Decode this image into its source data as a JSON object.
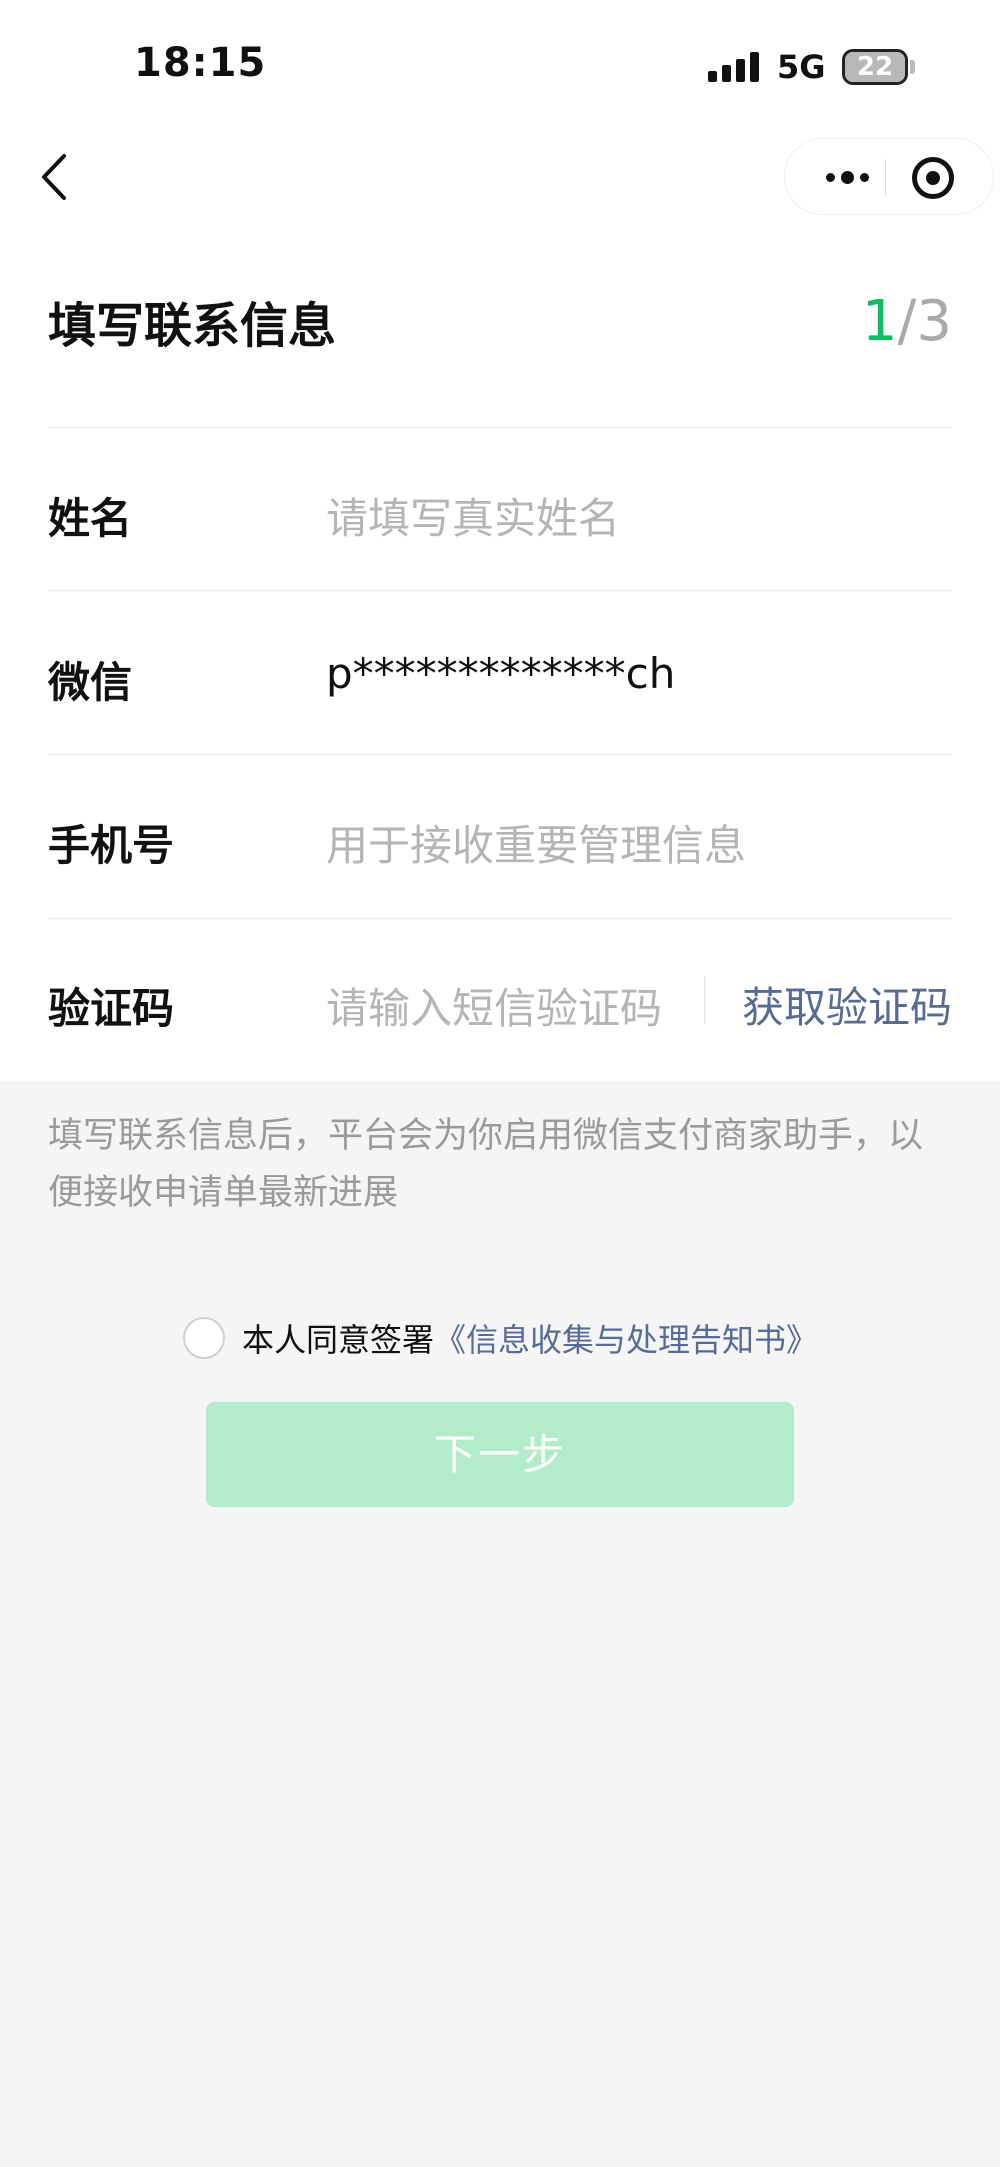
{
  "status_bar": {
    "time": "18:15",
    "network": "5G",
    "battery_level": "22"
  },
  "nav": {
    "back_icon": "chevron-left-icon",
    "more_icon": "more-dots-icon",
    "close_icon": "target-close-icon"
  },
  "header": {
    "title": "填写联系信息",
    "step_current": "1",
    "step_total": "/3"
  },
  "form": {
    "name": {
      "label": "姓名",
      "placeholder": "请填写真实姓名"
    },
    "wechat": {
      "label": "微信",
      "value": "p*************ch"
    },
    "phone": {
      "label": "手机号",
      "placeholder": "用于接收重要管理信息"
    },
    "code": {
      "label": "验证码",
      "placeholder": "请输入短信验证码",
      "action": "获取验证码"
    }
  },
  "note": "填写联系信息后，平台会为你启用微信支付商家助手，以便接收申请单最新进展",
  "agreement": {
    "prefix": "本人同意签署",
    "link": "《信息收集与处理告知书》",
    "checked": false
  },
  "next_button": {
    "label": "下一步",
    "enabled": false
  },
  "colors": {
    "accent": "#07c160",
    "link": "#576b95",
    "button_disabled": "#b3ecca",
    "background": "#f5f5f5"
  }
}
